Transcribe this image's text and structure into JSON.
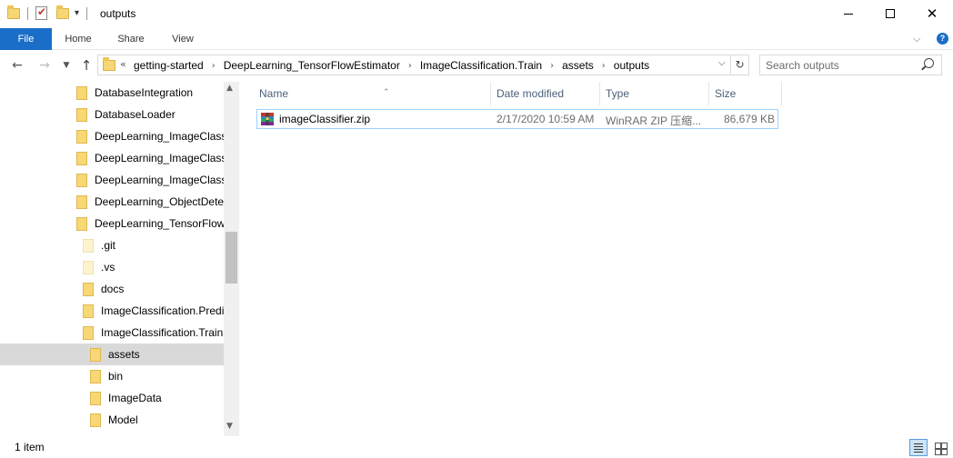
{
  "window": {
    "title": "outputs",
    "minimize_icon": "minimize-icon",
    "maximize_icon": "maximize-icon",
    "close_icon": "close-icon"
  },
  "ribbon": {
    "tabs": [
      {
        "label": "File"
      },
      {
        "label": "Home"
      },
      {
        "label": "Share"
      },
      {
        "label": "View"
      }
    ],
    "file_tab_color": "#1a6ec7"
  },
  "navbar": {
    "overflow": "«",
    "breadcrumbs": [
      {
        "label": "getting-started"
      },
      {
        "label": "DeepLearning_TensorFlowEstimator"
      },
      {
        "label": "ImageClassification.Train"
      },
      {
        "label": "assets"
      },
      {
        "label": "outputs"
      }
    ],
    "search": {
      "placeholder": "Search outputs"
    }
  },
  "tree": {
    "items": [
      {
        "label": "DatabaseIntegration"
      },
      {
        "label": "DatabaseLoader"
      },
      {
        "label": "DeepLearning_ImageClassif"
      },
      {
        "label": "DeepLearning_ImageClassif"
      },
      {
        "label": "DeepLearning_ImageClassif"
      },
      {
        "label": "DeepLearning_ObjectDetect"
      },
      {
        "label": "DeepLearning_TensorFlowE"
      },
      {
        "label": ".git"
      },
      {
        "label": ".vs"
      },
      {
        "label": "docs"
      },
      {
        "label": "ImageClassification.Predic"
      },
      {
        "label": "ImageClassification.Train"
      },
      {
        "label": "assets"
      },
      {
        "label": "bin"
      },
      {
        "label": "ImageData"
      },
      {
        "label": "Model"
      }
    ]
  },
  "content": {
    "columns": {
      "name": "Name",
      "date": "Date modified",
      "type": "Type",
      "size": "Size"
    },
    "rows": [
      {
        "name": "imageClassifier.zip",
        "date": "2/17/2020 10:59 AM",
        "type": "WinRAR ZIP 压缩...",
        "size": "86,679 KB",
        "icon": "winrar-archive-icon"
      }
    ]
  },
  "status": {
    "item_count": "1 item"
  },
  "colors": {
    "selection": "#d9d9d9",
    "row_border": "#99d1ff",
    "header_text": "#4c607a",
    "folder": "#f8d775"
  }
}
